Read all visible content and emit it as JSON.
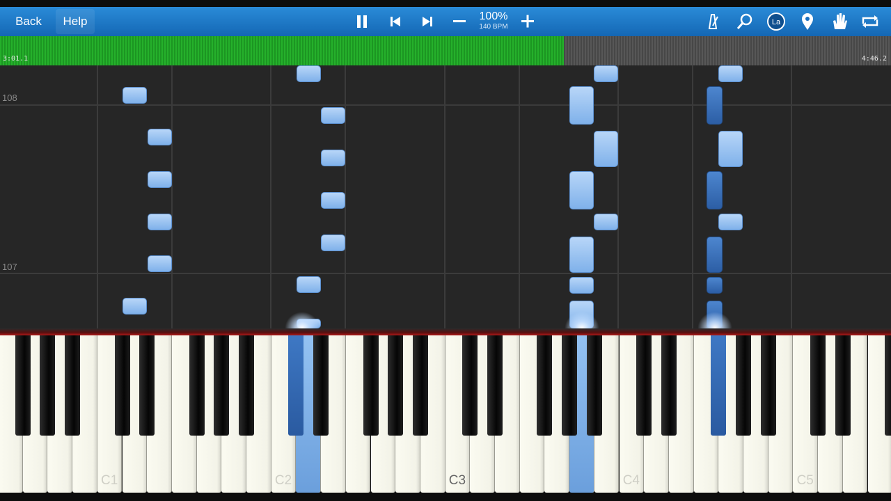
{
  "toolbar": {
    "back_label": "Back",
    "help_label": "Help",
    "zoom": "100%",
    "tempo": "140 BPM",
    "play_state_icon": "pause-icon",
    "right_icons": [
      "metronome-icon",
      "search-icon",
      "note-label-icon",
      "location-pin-icon",
      "hand-icon",
      "loop-icon"
    ],
    "note_label_text": "La",
    "colors": {
      "toolbar": "#1f78c8",
      "progress_fill": "#1fa326",
      "progress_track": "#555555"
    }
  },
  "progress": {
    "current_time": "3:01.1",
    "total_time": "4:46.2",
    "fraction_played": 0.633
  },
  "roll": {
    "measure_numbers": [
      "108",
      "107"
    ],
    "note_colors": {
      "light": "#9cc4f3",
      "dark": "#3a70bb"
    }
  },
  "keyboard": {
    "octave_labels": [
      "C1",
      "C2",
      "C3",
      "C4",
      "C5"
    ],
    "highlight_color": "#7fb1ea",
    "bar_color": "#b01818"
  }
}
